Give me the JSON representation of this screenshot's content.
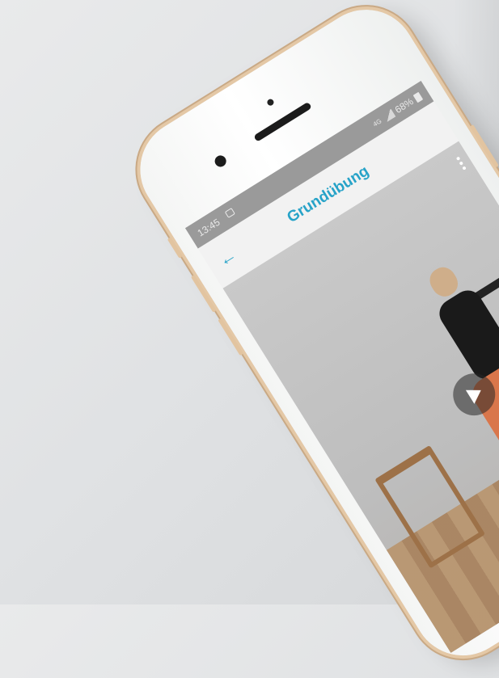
{
  "status_bar": {
    "time": "13:45",
    "network": "4G",
    "battery": "68%"
  },
  "app_bar": {
    "title": "Grundübung",
    "back_icon": "arrow-left-icon",
    "menu_icon": "more-vertical-icon"
  },
  "video": {
    "play_icon": "play-icon"
  },
  "colors": {
    "accent": "#27a3c8",
    "status_bar": "#9a9a9a",
    "background": "#e3e5e7"
  }
}
